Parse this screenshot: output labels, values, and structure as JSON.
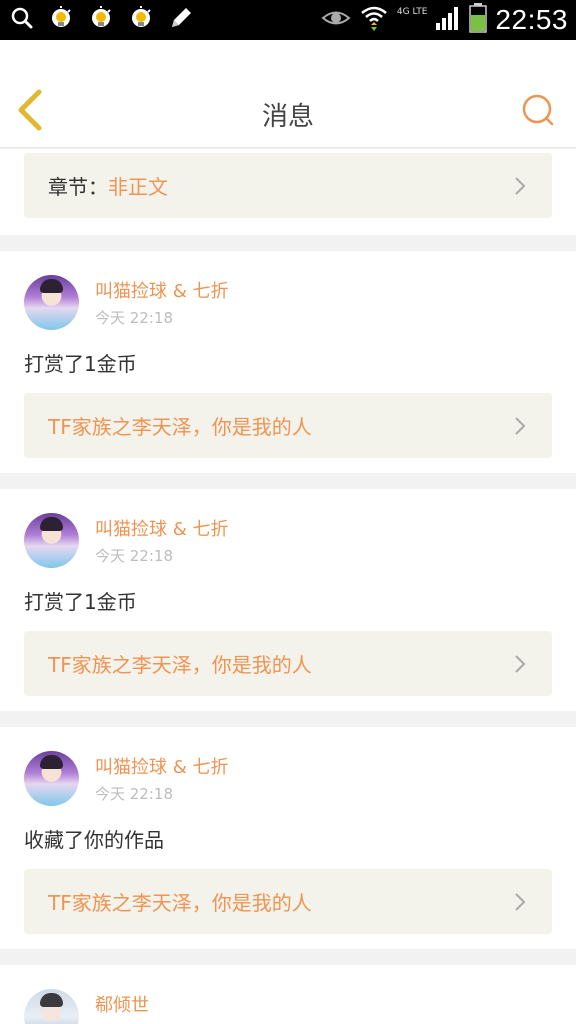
{
  "status_bar": {
    "time": "22:53",
    "network": "4G LTE",
    "icons": [
      "search-icon",
      "notification-bulb-icon",
      "notification-bulb-icon",
      "notification-bulb-icon",
      "pencil-icon",
      "eye-icon",
      "wifi-icon",
      "signal-icon",
      "battery-icon"
    ]
  },
  "header": {
    "title": "消息",
    "back_icon": "chevron-left-icon",
    "search_icon": "search-icon"
  },
  "chapter_card": {
    "label": "章节：",
    "value": "非正文"
  },
  "messages": [
    {
      "user": "叫猫捡球 & 七折",
      "time": "今天 22:18",
      "action": "打赏了1金币",
      "work_title": "TF家族之李天泽，你是我的人"
    },
    {
      "user": "叫猫捡球 & 七折",
      "time": "今天 22:18",
      "action": "打赏了1金币",
      "work_title": "TF家族之李天泽，你是我的人"
    },
    {
      "user": "叫猫捡球 & 七折",
      "time": "今天 22:18",
      "action": "收藏了你的作品",
      "work_title": "TF家族之李天泽，你是我的人"
    },
    {
      "user": "郗倾世"
    }
  ],
  "colors": {
    "accent": "#ef9452",
    "back_chevron": "#e0b830",
    "link_box_bg": "#f3f2eb",
    "page_bg": "#f2f2f2"
  }
}
